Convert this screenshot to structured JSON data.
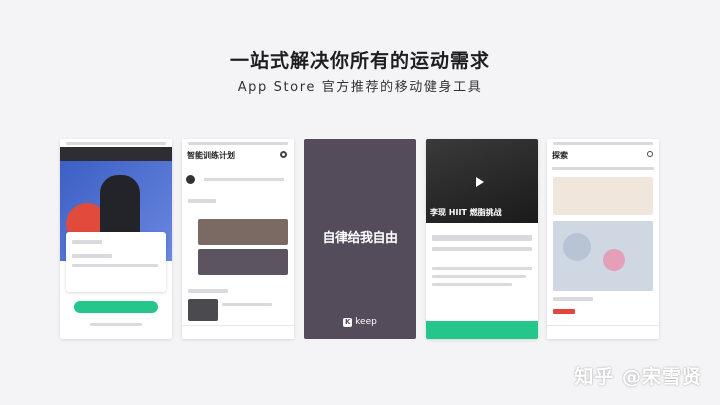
{
  "headline": "一站式解决你所有的运动需求",
  "subtitle": "App Store 官方推荐的移动健身工具",
  "phones": {
    "p2_title": "智能训练计划",
    "p4_title": "李现 HIIT 燃脂挑战",
    "p5_title": "探索"
  },
  "center": {
    "slogan": "自律给我自由",
    "logo": "keep"
  },
  "watermark": "知乎 @宋雪贤",
  "colors": {
    "accent": "#24c789",
    "card": "#544c5a",
    "hero_blue": "#4a6fd0",
    "hero_red": "#e04b3c"
  }
}
